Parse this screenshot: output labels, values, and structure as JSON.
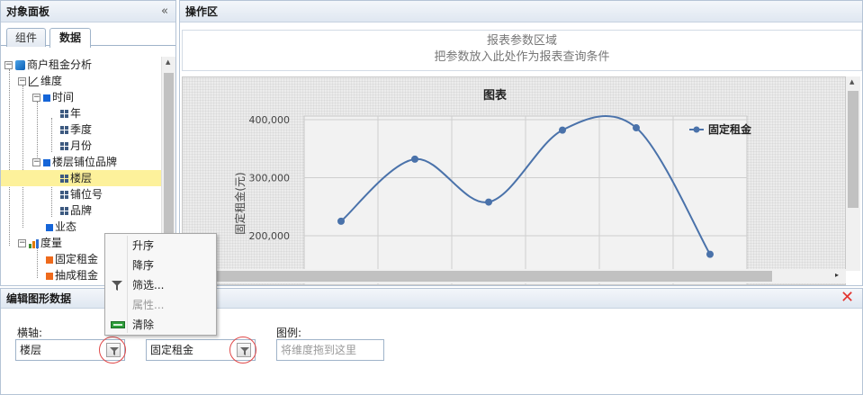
{
  "left_panel": {
    "title": "对象面板",
    "collapse_glyph": "«",
    "tabs": [
      {
        "label": "组件",
        "active": false
      },
      {
        "label": "数据",
        "active": true
      }
    ],
    "tree": {
      "root": "商户租金分析",
      "dimensions": "维度",
      "time": "时间",
      "year": "年",
      "quarter": "季度",
      "month": "月份",
      "floor_brand": "楼层铺位品牌",
      "floor": "楼层",
      "slot_no": "铺位号",
      "brand": "品牌",
      "business": "业态",
      "measures": "度量",
      "fixed_rent": "固定租金",
      "commission_rent": "抽成租金"
    }
  },
  "work_area": {
    "title": "操作区",
    "param_line1": "报表参数区域",
    "param_line2": "把参数放入此处作为报表查询条件"
  },
  "chart_data": {
    "type": "line",
    "title": "图表",
    "ylabel": "固定租金(元)",
    "xlabel": "",
    "y_ticks": [
      "400,000",
      "300,000",
      "200,000"
    ],
    "y_tick_values": [
      400000,
      300000,
      200000
    ],
    "series": [
      {
        "name": "固定租金",
        "values": [
          225000,
          332000,
          258000,
          382000,
          386000,
          168000
        ]
      }
    ],
    "legend_position": "top-right",
    "grid": true,
    "line_color": "#4a72aa"
  },
  "edit_panel": {
    "title": "编辑图形数据",
    "x_axis_label": "横轴:",
    "x_axis_value": "楼层",
    "value_field": "固定租金",
    "legend_label": "图例:",
    "legend_placeholder": "将维度拖到这里"
  },
  "context_menu": {
    "items": [
      {
        "label": "升序",
        "disabled": false,
        "icon": ""
      },
      {
        "label": "降序",
        "disabled": false,
        "icon": ""
      },
      {
        "label": "筛选...",
        "disabled": false,
        "icon": "filter-icon"
      },
      {
        "label": "属性...",
        "disabled": true,
        "icon": ""
      },
      {
        "label": "清除",
        "disabled": false,
        "icon": "clear-icon"
      }
    ]
  }
}
